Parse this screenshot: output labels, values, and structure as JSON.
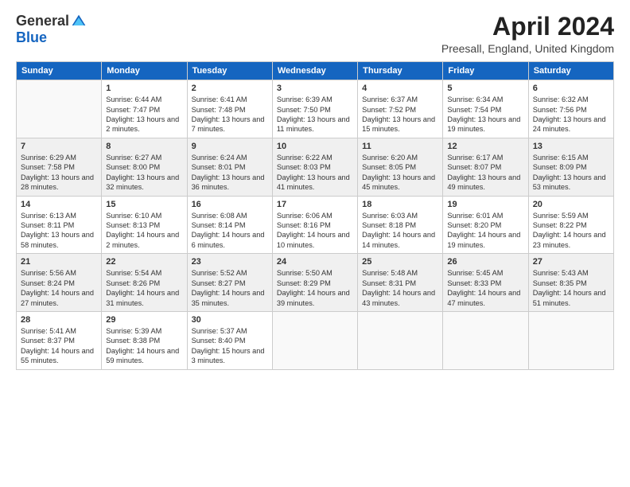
{
  "header": {
    "logo_general": "General",
    "logo_blue": "Blue",
    "month_title": "April 2024",
    "location": "Preesall, England, United Kingdom"
  },
  "days_of_week": [
    "Sunday",
    "Monday",
    "Tuesday",
    "Wednesday",
    "Thursday",
    "Friday",
    "Saturday"
  ],
  "weeks": [
    [
      {
        "day": "",
        "sunrise": "",
        "sunset": "",
        "daylight": ""
      },
      {
        "day": "1",
        "sunrise": "Sunrise: 6:44 AM",
        "sunset": "Sunset: 7:47 PM",
        "daylight": "Daylight: 13 hours and 2 minutes."
      },
      {
        "day": "2",
        "sunrise": "Sunrise: 6:41 AM",
        "sunset": "Sunset: 7:48 PM",
        "daylight": "Daylight: 13 hours and 7 minutes."
      },
      {
        "day": "3",
        "sunrise": "Sunrise: 6:39 AM",
        "sunset": "Sunset: 7:50 PM",
        "daylight": "Daylight: 13 hours and 11 minutes."
      },
      {
        "day": "4",
        "sunrise": "Sunrise: 6:37 AM",
        "sunset": "Sunset: 7:52 PM",
        "daylight": "Daylight: 13 hours and 15 minutes."
      },
      {
        "day": "5",
        "sunrise": "Sunrise: 6:34 AM",
        "sunset": "Sunset: 7:54 PM",
        "daylight": "Daylight: 13 hours and 19 minutes."
      },
      {
        "day": "6",
        "sunrise": "Sunrise: 6:32 AM",
        "sunset": "Sunset: 7:56 PM",
        "daylight": "Daylight: 13 hours and 24 minutes."
      }
    ],
    [
      {
        "day": "7",
        "sunrise": "Sunrise: 6:29 AM",
        "sunset": "Sunset: 7:58 PM",
        "daylight": "Daylight: 13 hours and 28 minutes."
      },
      {
        "day": "8",
        "sunrise": "Sunrise: 6:27 AM",
        "sunset": "Sunset: 8:00 PM",
        "daylight": "Daylight: 13 hours and 32 minutes."
      },
      {
        "day": "9",
        "sunrise": "Sunrise: 6:24 AM",
        "sunset": "Sunset: 8:01 PM",
        "daylight": "Daylight: 13 hours and 36 minutes."
      },
      {
        "day": "10",
        "sunrise": "Sunrise: 6:22 AM",
        "sunset": "Sunset: 8:03 PM",
        "daylight": "Daylight: 13 hours and 41 minutes."
      },
      {
        "day": "11",
        "sunrise": "Sunrise: 6:20 AM",
        "sunset": "Sunset: 8:05 PM",
        "daylight": "Daylight: 13 hours and 45 minutes."
      },
      {
        "day": "12",
        "sunrise": "Sunrise: 6:17 AM",
        "sunset": "Sunset: 8:07 PM",
        "daylight": "Daylight: 13 hours and 49 minutes."
      },
      {
        "day": "13",
        "sunrise": "Sunrise: 6:15 AM",
        "sunset": "Sunset: 8:09 PM",
        "daylight": "Daylight: 13 hours and 53 minutes."
      }
    ],
    [
      {
        "day": "14",
        "sunrise": "Sunrise: 6:13 AM",
        "sunset": "Sunset: 8:11 PM",
        "daylight": "Daylight: 13 hours and 58 minutes."
      },
      {
        "day": "15",
        "sunrise": "Sunrise: 6:10 AM",
        "sunset": "Sunset: 8:13 PM",
        "daylight": "Daylight: 14 hours and 2 minutes."
      },
      {
        "day": "16",
        "sunrise": "Sunrise: 6:08 AM",
        "sunset": "Sunset: 8:14 PM",
        "daylight": "Daylight: 14 hours and 6 minutes."
      },
      {
        "day": "17",
        "sunrise": "Sunrise: 6:06 AM",
        "sunset": "Sunset: 8:16 PM",
        "daylight": "Daylight: 14 hours and 10 minutes."
      },
      {
        "day": "18",
        "sunrise": "Sunrise: 6:03 AM",
        "sunset": "Sunset: 8:18 PM",
        "daylight": "Daylight: 14 hours and 14 minutes."
      },
      {
        "day": "19",
        "sunrise": "Sunrise: 6:01 AM",
        "sunset": "Sunset: 8:20 PM",
        "daylight": "Daylight: 14 hours and 19 minutes."
      },
      {
        "day": "20",
        "sunrise": "Sunrise: 5:59 AM",
        "sunset": "Sunset: 8:22 PM",
        "daylight": "Daylight: 14 hours and 23 minutes."
      }
    ],
    [
      {
        "day": "21",
        "sunrise": "Sunrise: 5:56 AM",
        "sunset": "Sunset: 8:24 PM",
        "daylight": "Daylight: 14 hours and 27 minutes."
      },
      {
        "day": "22",
        "sunrise": "Sunrise: 5:54 AM",
        "sunset": "Sunset: 8:26 PM",
        "daylight": "Daylight: 14 hours and 31 minutes."
      },
      {
        "day": "23",
        "sunrise": "Sunrise: 5:52 AM",
        "sunset": "Sunset: 8:27 PM",
        "daylight": "Daylight: 14 hours and 35 minutes."
      },
      {
        "day": "24",
        "sunrise": "Sunrise: 5:50 AM",
        "sunset": "Sunset: 8:29 PM",
        "daylight": "Daylight: 14 hours and 39 minutes."
      },
      {
        "day": "25",
        "sunrise": "Sunrise: 5:48 AM",
        "sunset": "Sunset: 8:31 PM",
        "daylight": "Daylight: 14 hours and 43 minutes."
      },
      {
        "day": "26",
        "sunrise": "Sunrise: 5:45 AM",
        "sunset": "Sunset: 8:33 PM",
        "daylight": "Daylight: 14 hours and 47 minutes."
      },
      {
        "day": "27",
        "sunrise": "Sunrise: 5:43 AM",
        "sunset": "Sunset: 8:35 PM",
        "daylight": "Daylight: 14 hours and 51 minutes."
      }
    ],
    [
      {
        "day": "28",
        "sunrise": "Sunrise: 5:41 AM",
        "sunset": "Sunset: 8:37 PM",
        "daylight": "Daylight: 14 hours and 55 minutes."
      },
      {
        "day": "29",
        "sunrise": "Sunrise: 5:39 AM",
        "sunset": "Sunset: 8:38 PM",
        "daylight": "Daylight: 14 hours and 59 minutes."
      },
      {
        "day": "30",
        "sunrise": "Sunrise: 5:37 AM",
        "sunset": "Sunset: 8:40 PM",
        "daylight": "Daylight: 15 hours and 3 minutes."
      },
      {
        "day": "",
        "sunrise": "",
        "sunset": "",
        "daylight": ""
      },
      {
        "day": "",
        "sunrise": "",
        "sunset": "",
        "daylight": ""
      },
      {
        "day": "",
        "sunrise": "",
        "sunset": "",
        "daylight": ""
      },
      {
        "day": "",
        "sunrise": "",
        "sunset": "",
        "daylight": ""
      }
    ]
  ]
}
